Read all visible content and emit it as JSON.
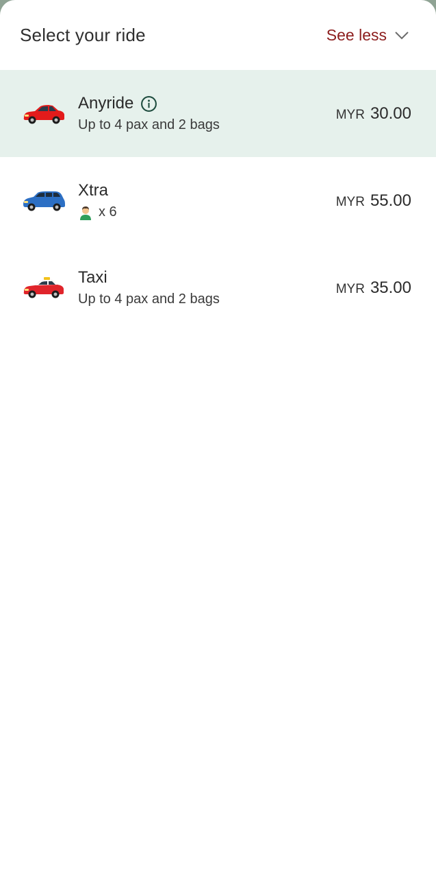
{
  "header": {
    "title": "Select your ride",
    "toggle_label": "See less",
    "toggle_icon": "chevron-down-icon"
  },
  "colors": {
    "accent": "#8c1d1d",
    "selected_bg": "#e6f1ec",
    "info_icon": "#1f4d3f"
  },
  "rides": [
    {
      "name": "Anyride",
      "subtitle": "Up to 4 pax and 2 bags",
      "currency": "MYR",
      "amount": "30.00",
      "selected": true,
      "icon": "red-sedan-icon"
    },
    {
      "name": "Xtra",
      "subtitle": "x 6",
      "currency": "MYR",
      "amount": "55.00",
      "selected": false,
      "icon": "blue-mpv-icon",
      "subtitle_icon": "person-icon"
    },
    {
      "name": "Taxi",
      "subtitle": "Up to 4 pax and 2 bags",
      "currency": "MYR",
      "amount": "35.00",
      "selected": false,
      "icon": "red-taxi-icon"
    }
  ]
}
